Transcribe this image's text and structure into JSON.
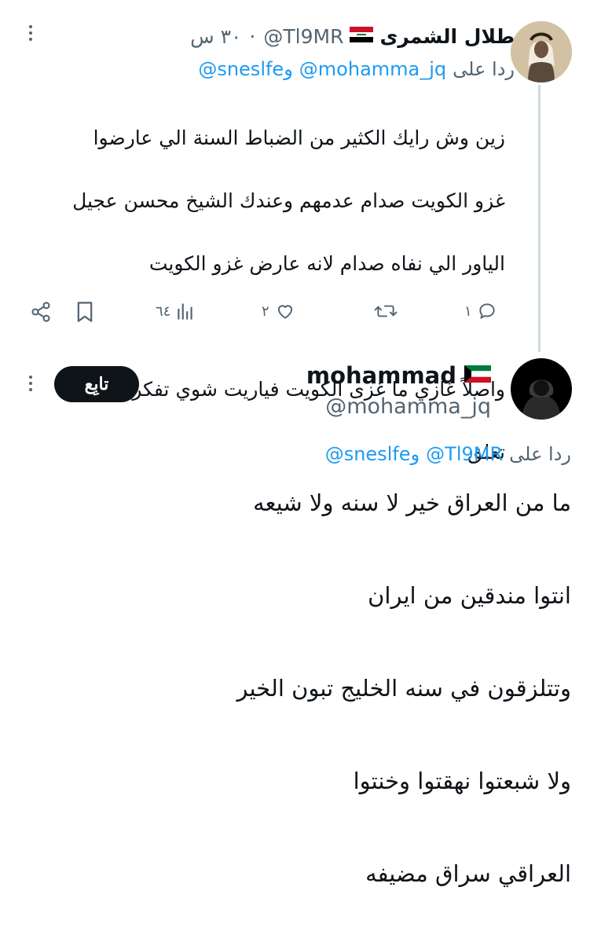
{
  "tweet1": {
    "display_name": "طلال الشمرى",
    "handle": "@Tl9MR",
    "time": "٣٠ س",
    "flag_icon": "iraq-flag-icon",
    "reply_prefix": "ردا على",
    "reply_to_1": "@mohamma_jq",
    "reply_conj": "و",
    "reply_to_2": "@sneslfe",
    "text_line_1": "زين وش رايك الكثير من الضباط السنة الي عارضوا",
    "text_line_2": "غزو الكويت صدام عدمهم وعندك الشيخ محسن عجيل",
    "text_line_3": "الياور الي نفاه صدام لانه عارض غزو الكويت",
    "text_line_4": "واصلاً غازي ما غزى الكويت فياريت شوي تفكر قبل لا",
    "text_line_5": "تعلق",
    "actions": {
      "reply_count": "١",
      "retweet_count": "",
      "like_count": "٢",
      "views_count": "٦٤"
    }
  },
  "tweet2": {
    "display_name": "mohammad",
    "handle": "@mohamma_jq",
    "flag_icon": "kuwait-flag-icon",
    "follow_label": "تابِع",
    "reply_prefix": "ردا على",
    "reply_to_1": "@Tl9MR",
    "reply_conj": "و",
    "reply_to_2": "@sneslfe",
    "paragraphs": [
      "ما من العراق خير لا سنه ولا شيعه",
      "انتوا مندقين من ايران",
      "وتتلزقون في سنه الخليج تبون الخير",
      "ولا شبعتوا نهقتوا وخنتوا",
      "العراقي سراق مضيفه"
    ]
  },
  "colors": {
    "text_primary": "#0f1419",
    "text_secondary": "#536471",
    "mention": "#1d9bf0",
    "follow_bg": "#0f1419",
    "thread_line": "#cfd9de"
  }
}
